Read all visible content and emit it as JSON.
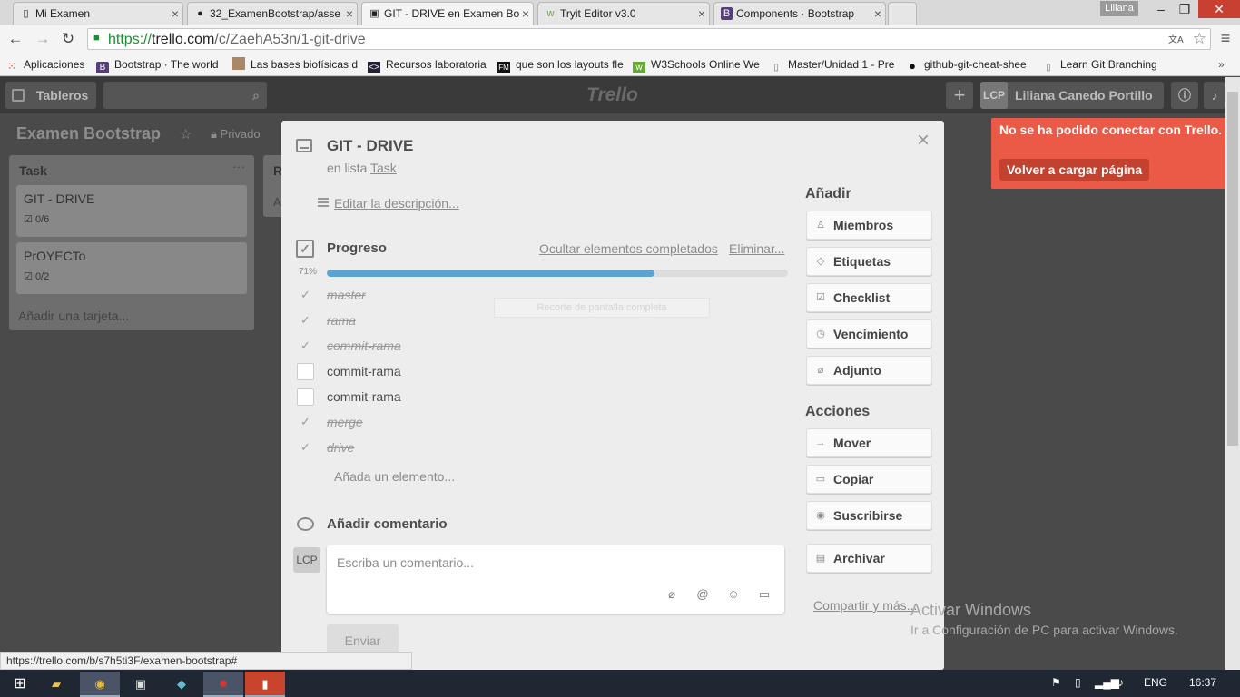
{
  "browser": {
    "tabs": [
      {
        "icon": "document-icon",
        "label": "Mi Examen"
      },
      {
        "icon": "github-icon",
        "label": "32_ExamenBootstrap/asse"
      },
      {
        "icon": "trello-icon",
        "label": "GIT - DRIVE en Examen Bo"
      },
      {
        "icon": "w3-icon",
        "label": "Tryit Editor v3.0"
      },
      {
        "icon": "bootstrap-icon",
        "label": "Components · Bootstrap"
      }
    ],
    "user_badge": "Liliana",
    "url_scheme": "https://",
    "url_host": "trello.com",
    "url_path": "/c/ZaehA53n/1-git-drive",
    "bookmarks": [
      {
        "icon": "apps-icon",
        "label": "Aplicaciones"
      },
      {
        "icon": "bootstrap-icon",
        "label": "Bootstrap · The world"
      },
      {
        "icon": "person-icon",
        "label": "Las bases biofísicas d"
      },
      {
        "icon": "code-icon",
        "label": "Recursos laboratoria"
      },
      {
        "icon": "fm-icon",
        "label": "que son los layouts fle"
      },
      {
        "icon": "w3-icon",
        "label": "W3Schools Online We"
      },
      {
        "icon": "document-icon",
        "label": "Master/Unidad 1 - Pre"
      },
      {
        "icon": "github-icon",
        "label": "github-git-cheat-shee"
      },
      {
        "icon": "document-icon",
        "label": "Learn Git Branching"
      }
    ]
  },
  "header": {
    "boards_label": "Tableros",
    "logo_text": "Trello",
    "initials": "LCP",
    "user_name": "Liliana Canedo Portillo"
  },
  "board": {
    "title": "Examen Bootstrap",
    "visibility": "Privado",
    "list_name": "Task",
    "list2_initial": "R",
    "list2_text": "A",
    "cards": [
      {
        "title": "GIT - DRIVE",
        "badge": "0/6"
      },
      {
        "title": "PrOYECTo",
        "badge": "0/2"
      }
    ],
    "add_card": "Añadir una tarjeta..."
  },
  "modal": {
    "title": "GIT - DRIVE",
    "in_list_prefix": "en lista",
    "list_link": "Task",
    "edit_desc": "Editar la descripción...",
    "checklist_title": "Progreso",
    "hide_completed": "Ocultar elementos completados",
    "delete": "Eliminar...",
    "percent_text": "71%",
    "progress": 0.71,
    "items": [
      {
        "text": "master",
        "done": true
      },
      {
        "text": "rama",
        "done": true
      },
      {
        "text": "commit-rama",
        "done": true
      },
      {
        "text": "commit-rama",
        "done": false
      },
      {
        "text": "commit-rama",
        "done": false
      },
      {
        "text": "merge",
        "done": true
      },
      {
        "text": "drive",
        "done": true
      }
    ],
    "add_item": "Añada un elemento...",
    "comment_title": "Añadir comentario",
    "avatar": "LCP",
    "comment_placeholder": "Escriba un comentario...",
    "send": "Enviar",
    "screenshot_tip": "Recorte de pantalla completa",
    "add_header": "Añadir",
    "add_buttons": [
      {
        "icon": "person-icon",
        "label": "Miembros"
      },
      {
        "icon": "tag-icon",
        "label": "Etiquetas"
      },
      {
        "icon": "checklist-icon",
        "label": "Checklist"
      },
      {
        "icon": "clock-icon",
        "label": "Vencimiento"
      },
      {
        "icon": "paperclip-icon",
        "label": "Adjunto"
      }
    ],
    "actions_header": "Acciones",
    "action_buttons": [
      {
        "icon": "arrow-right-icon",
        "label": "Mover"
      },
      {
        "icon": "card-icon",
        "label": "Copiar"
      },
      {
        "icon": "eye-icon",
        "label": "Suscribirse"
      },
      {
        "icon": "archive-icon",
        "label": "Archivar"
      }
    ],
    "share": "Compartir y más..."
  },
  "alert": {
    "message": "No se ha podido conectar con Trello.",
    "button": "Volver a cargar página",
    "color": "#eb5a46"
  },
  "status_url": "https://trello.com/b/s7h5ti3F/examen-bootstrap#",
  "windows": {
    "activate_title": "Activar Windows",
    "activate_text": "Ir a Configuración de PC para activar Windows.",
    "lang": "ENG",
    "time": "16:37"
  }
}
